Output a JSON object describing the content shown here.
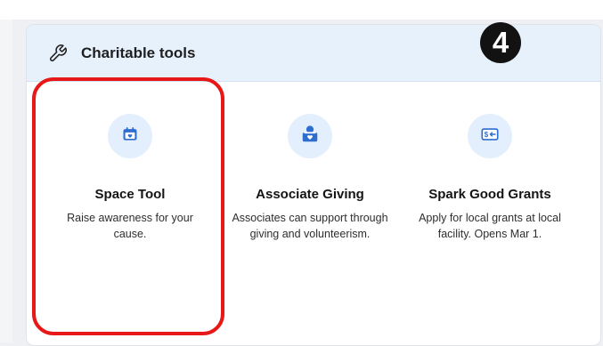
{
  "section": {
    "title": "Charitable tools",
    "step_badge": "4"
  },
  "tools": [
    {
      "title": "Space Tool",
      "description": "Raise awareness for your cause.",
      "icon": "calendar-heart-icon"
    },
    {
      "title": "Associate Giving",
      "description": "Associates can support through giving and volunteerism.",
      "icon": "donation-box-icon"
    },
    {
      "title": "Spark Good Grants",
      "description": "Apply for local grants at local facility. Opens Mar 1.",
      "icon": "money-transfer-icon"
    }
  ],
  "colors": {
    "accent": "#2e6ecf",
    "header_background": "#e6f1fc",
    "highlight": "#e81818"
  }
}
